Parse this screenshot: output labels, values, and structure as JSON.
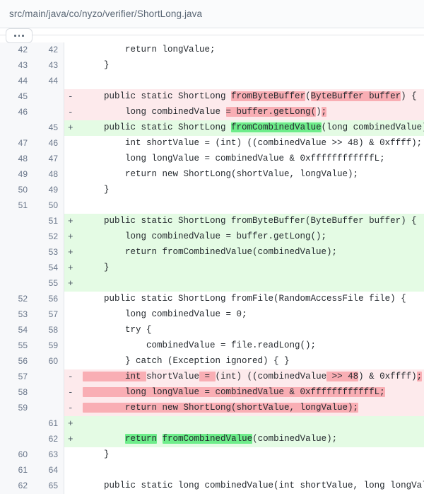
{
  "header": {
    "file_path": "src/main/java/co/nyzo/verifier/ShortLong.java"
  },
  "expander": {
    "label": "...",
    "name": "expand-hidden-lines"
  },
  "diff": {
    "rows": [
      {
        "old": "42",
        "new": "42",
        "marker": " ",
        "kind": "ctx",
        "segments": [
          {
            "t": "        return longValue;",
            "h": "none"
          }
        ]
      },
      {
        "old": "43",
        "new": "43",
        "marker": " ",
        "kind": "ctx",
        "segments": [
          {
            "t": "    }",
            "h": "none"
          }
        ]
      },
      {
        "old": "44",
        "new": "44",
        "marker": " ",
        "kind": "ctx",
        "segments": [
          {
            "t": "",
            "h": "none"
          }
        ]
      },
      {
        "old": "45",
        "new": "",
        "marker": "-",
        "kind": "del",
        "segments": [
          {
            "t": "    public static ShortLong ",
            "h": "none"
          },
          {
            "t": "fromByteBuffer",
            "h": "del"
          },
          {
            "t": "(",
            "h": "none"
          },
          {
            "t": "ByteBuffer buffer",
            "h": "del"
          },
          {
            "t": ") {",
            "h": "none"
          }
        ]
      },
      {
        "old": "46",
        "new": "",
        "marker": "-",
        "kind": "del",
        "segments": [
          {
            "t": "        long combinedValue ",
            "h": "none"
          },
          {
            "t": "= buffer.getLong(",
            "h": "del"
          },
          {
            "t": ")",
            "h": "none"
          },
          {
            "t": ";",
            "h": "del"
          }
        ]
      },
      {
        "old": "",
        "new": "45",
        "marker": "+",
        "kind": "add",
        "segments": [
          {
            "t": "    public static ShortLong ",
            "h": "none"
          },
          {
            "t": "fromCombinedValue",
            "h": "add"
          },
          {
            "t": "(long combinedValue) ",
            "h": "none"
          },
          {
            "t": "{",
            "h": "add"
          }
        ]
      },
      {
        "old": "47",
        "new": "46",
        "marker": " ",
        "kind": "ctx",
        "segments": [
          {
            "t": "        int shortValue = (int) ((combinedValue >> 48) & 0xffff);",
            "h": "none"
          }
        ]
      },
      {
        "old": "48",
        "new": "47",
        "marker": " ",
        "kind": "ctx",
        "segments": [
          {
            "t": "        long longValue = combinedValue & 0xffffffffffffL;",
            "h": "none"
          }
        ]
      },
      {
        "old": "49",
        "new": "48",
        "marker": " ",
        "kind": "ctx",
        "segments": [
          {
            "t": "        return new ShortLong(shortValue, longValue);",
            "h": "none"
          }
        ]
      },
      {
        "old": "50",
        "new": "49",
        "marker": " ",
        "kind": "ctx",
        "segments": [
          {
            "t": "    }",
            "h": "none"
          }
        ]
      },
      {
        "old": "51",
        "new": "50",
        "marker": " ",
        "kind": "ctx",
        "segments": [
          {
            "t": "",
            "h": "none"
          }
        ]
      },
      {
        "old": "",
        "new": "51",
        "marker": "+",
        "kind": "add",
        "segments": [
          {
            "t": "    public static ShortLong fromByteBuffer(ByteBuffer buffer) {",
            "h": "none"
          }
        ]
      },
      {
        "old": "",
        "new": "52",
        "marker": "+",
        "kind": "add",
        "segments": [
          {
            "t": "        long combinedValue = buffer.getLong();",
            "h": "none"
          }
        ]
      },
      {
        "old": "",
        "new": "53",
        "marker": "+",
        "kind": "add",
        "segments": [
          {
            "t": "        return fromCombinedValue(combinedValue);",
            "h": "none"
          }
        ]
      },
      {
        "old": "",
        "new": "54",
        "marker": "+",
        "kind": "add",
        "segments": [
          {
            "t": "    }",
            "h": "none"
          }
        ]
      },
      {
        "old": "",
        "new": "55",
        "marker": "+",
        "kind": "add",
        "segments": [
          {
            "t": "",
            "h": "none"
          }
        ]
      },
      {
        "old": "52",
        "new": "56",
        "marker": " ",
        "kind": "ctx",
        "segments": [
          {
            "t": "    public static ShortLong fromFile(RandomAccessFile file) {",
            "h": "none"
          }
        ]
      },
      {
        "old": "53",
        "new": "57",
        "marker": " ",
        "kind": "ctx",
        "segments": [
          {
            "t": "        long combinedValue = 0;",
            "h": "none"
          }
        ]
      },
      {
        "old": "54",
        "new": "58",
        "marker": " ",
        "kind": "ctx",
        "segments": [
          {
            "t": "        try {",
            "h": "none"
          }
        ]
      },
      {
        "old": "55",
        "new": "59",
        "marker": " ",
        "kind": "ctx",
        "segments": [
          {
            "t": "            combinedValue = file.readLong();",
            "h": "none"
          }
        ]
      },
      {
        "old": "56",
        "new": "60",
        "marker": " ",
        "kind": "ctx",
        "segments": [
          {
            "t": "        } catch (Exception ignored) { }",
            "h": "none"
          }
        ]
      },
      {
        "old": "57",
        "new": "",
        "marker": "-",
        "kind": "del",
        "segments": [
          {
            "t": "        int ",
            "h": "del"
          },
          {
            "t": "shortValue",
            "h": "none"
          },
          {
            "t": " = ",
            "h": "del"
          },
          {
            "t": "(int) ((combinedValue",
            "h": "none"
          },
          {
            "t": " >> 48",
            "h": "del"
          },
          {
            "t": ") & 0xffff)",
            "h": "none"
          },
          {
            "t": ";",
            "h": "del"
          }
        ]
      },
      {
        "old": "58",
        "new": "",
        "marker": "-",
        "kind": "del",
        "segments": [
          {
            "t": "        long longValue = combinedValue & 0xffffffffffffL;",
            "h": "del"
          }
        ]
      },
      {
        "old": "59",
        "new": "",
        "marker": "-",
        "kind": "del",
        "segments": [
          {
            "t": "        return new ShortLong(shortValue, longValue);",
            "h": "del"
          }
        ]
      },
      {
        "old": "",
        "new": "61",
        "marker": "+",
        "kind": "add",
        "segments": [
          {
            "t": "",
            "h": "none"
          }
        ]
      },
      {
        "old": "",
        "new": "62",
        "marker": "+",
        "kind": "add",
        "segments": [
          {
            "t": "        ",
            "h": "none"
          },
          {
            "t": "return",
            "h": "add"
          },
          {
            "t": " ",
            "h": "none"
          },
          {
            "t": "fromCombinedValue",
            "h": "add"
          },
          {
            "t": "(combinedValue);",
            "h": "none"
          }
        ]
      },
      {
        "old": "60",
        "new": "63",
        "marker": " ",
        "kind": "ctx",
        "segments": [
          {
            "t": "    }",
            "h": "none"
          }
        ]
      },
      {
        "old": "61",
        "new": "64",
        "marker": " ",
        "kind": "ctx",
        "segments": [
          {
            "t": "",
            "h": "none"
          }
        ]
      },
      {
        "old": "62",
        "new": "65",
        "marker": " ",
        "kind": "ctx",
        "segments": [
          {
            "t": "    public static long combinedValue(int shortValue, long longValue) {",
            "h": "none"
          }
        ]
      }
    ]
  },
  "colors": {
    "add_bg": "#e4fbe4",
    "del_bg": "#fdeaec",
    "add_word": "#6ded8a",
    "del_word": "#f9aeb4",
    "gutter_bg": "#f7f8fa",
    "header_bg": "#fafbfc",
    "text": "#24292e"
  }
}
